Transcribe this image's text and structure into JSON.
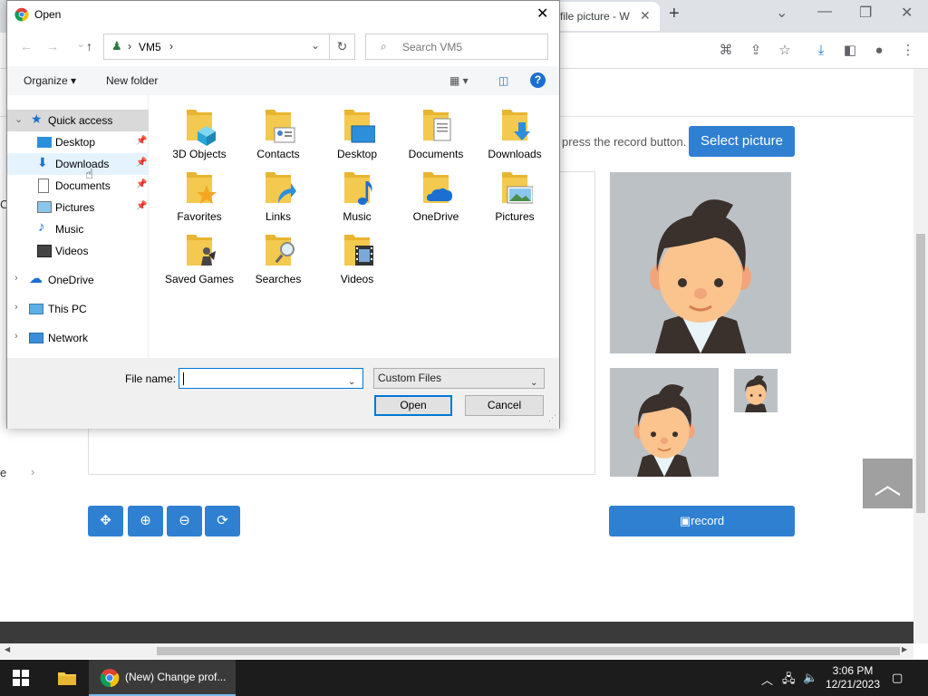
{
  "browser": {
    "tab_title": "file picture - W",
    "new_tab": "+",
    "window_controls": [
      "chevron-down-icon",
      "minimize-icon",
      "restore-icon",
      "close-icon"
    ]
  },
  "page": {
    "instruction": "press the record button.",
    "select_button": "Select picture",
    "record_button": "record",
    "left_c": "C",
    "left_e": "e"
  },
  "dialog": {
    "title": "Open",
    "address": {
      "separator": "›",
      "location": "VM5",
      "trail": "›"
    },
    "search_placeholder": "Search VM5",
    "commands": {
      "organize": "Organize",
      "new_folder": "New folder"
    },
    "nav": {
      "quick_access": "Quick access",
      "items": [
        {
          "label": "Desktop",
          "icon": "desktop-icon",
          "pinned": true
        },
        {
          "label": "Downloads",
          "icon": "downloads-icon",
          "pinned": true
        },
        {
          "label": "Documents",
          "icon": "documents-icon",
          "pinned": true
        },
        {
          "label": "Pictures",
          "icon": "pictures-icon",
          "pinned": true
        },
        {
          "label": "Music",
          "icon": "music-icon",
          "pinned": false
        },
        {
          "label": "Videos",
          "icon": "videos-icon",
          "pinned": false
        }
      ],
      "onedrive": "OneDrive",
      "this_pc": "This PC",
      "network": "Network"
    },
    "folders": [
      {
        "label": "3D Objects",
        "icon": "3d-objects-folder-icon"
      },
      {
        "label": "Contacts",
        "icon": "contacts-folder-icon"
      },
      {
        "label": "Desktop",
        "icon": "desktop-folder-icon"
      },
      {
        "label": "Documents",
        "icon": "documents-folder-icon"
      },
      {
        "label": "Downloads",
        "icon": "downloads-folder-icon"
      },
      {
        "label": "Favorites",
        "icon": "favorites-folder-icon"
      },
      {
        "label": "Links",
        "icon": "links-folder-icon"
      },
      {
        "label": "Music",
        "icon": "music-folder-icon"
      },
      {
        "label": "OneDrive",
        "icon": "onedrive-folder-icon"
      },
      {
        "label": "Pictures",
        "icon": "pictures-folder-icon"
      },
      {
        "label": "Saved Games",
        "icon": "saved-games-folder-icon"
      },
      {
        "label": "Searches",
        "icon": "searches-folder-icon"
      },
      {
        "label": "Videos",
        "icon": "videos-folder-icon"
      }
    ],
    "file_name_label": "File name:",
    "file_name_value": "",
    "file_type": "Custom Files",
    "open_button": "Open",
    "cancel_button": "Cancel"
  },
  "taskbar": {
    "chrome_label": "(New) Change prof...",
    "time": "3:06 PM",
    "date": "12/21/2023"
  },
  "colors": {
    "accent": "#2f80d1",
    "folder": "#f3c94f",
    "selection": "#0078d7"
  }
}
